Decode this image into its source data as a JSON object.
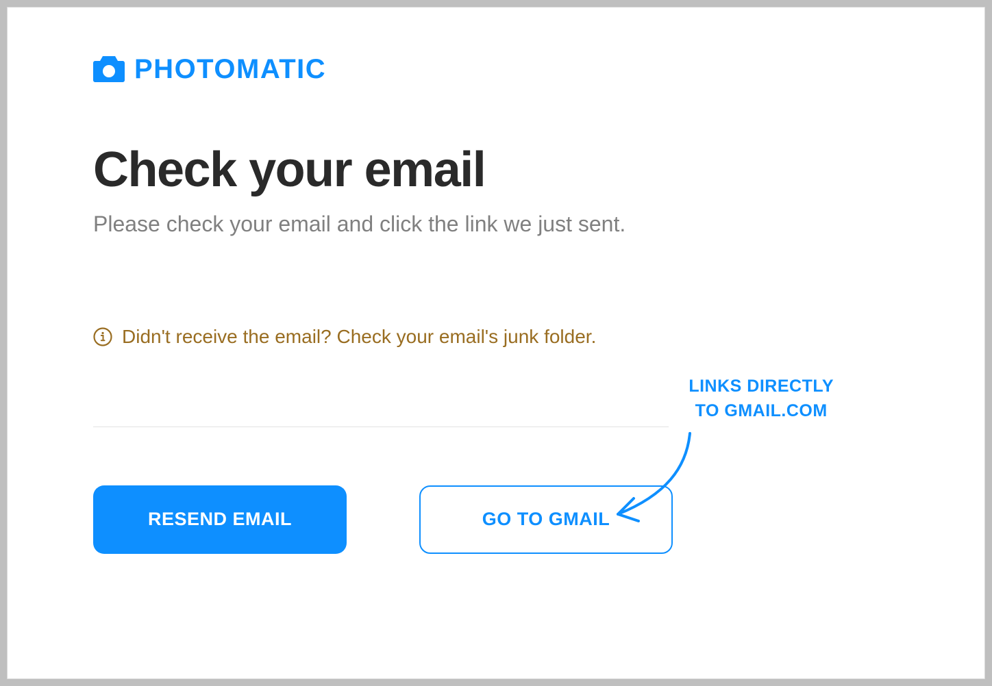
{
  "brand": {
    "name": "PHOTOMATIC"
  },
  "heading": "Check your email",
  "subheading": "Please check your email and click the link we just sent.",
  "hint": "Didn't receive the email? Check your email's junk folder.",
  "buttons": {
    "resend": "RESEND EMAIL",
    "goto_gmail": "GO TO GMAIL"
  },
  "annotation": {
    "line1": "LINKS DIRECTLY",
    "line2": "TO GMAIL.COM"
  },
  "colors": {
    "brand": "#0E8FFF",
    "hint": "#996d21",
    "text_dark": "#2a2a2a",
    "text_muted": "#808080"
  }
}
